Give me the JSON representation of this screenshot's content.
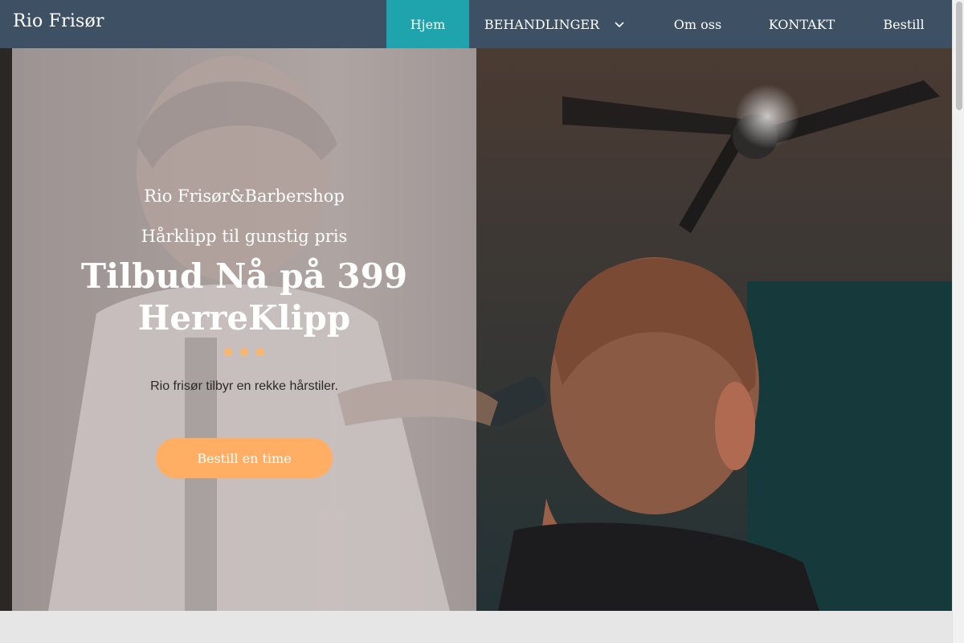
{
  "header": {
    "brand": "Rio Frisør",
    "nav": [
      {
        "label": "Hjem",
        "active": true
      },
      {
        "label": "BEHANDLINGER",
        "has_dropdown": true
      },
      {
        "label": "Om oss"
      },
      {
        "label": "KONTAKT"
      },
      {
        "label": "Bestill"
      }
    ]
  },
  "hero": {
    "subtitle1": "Rio Frisør&Barbershop",
    "subtitle2": "Hårklipp til gunstig pris",
    "title_line1": "Tilbud Nå på 399",
    "title_line2": "HerreKlipp",
    "text": "Rio frisør tilbyr en rekke hårstiler.",
    "cta_label": "Bestill en time"
  },
  "colors": {
    "navbar": "#3e5064",
    "active_nav": "#1fa3ac",
    "accent": "#ffae64",
    "dots": "#ffb56b"
  },
  "icons": {
    "dropdown": "chevron-down-icon"
  }
}
